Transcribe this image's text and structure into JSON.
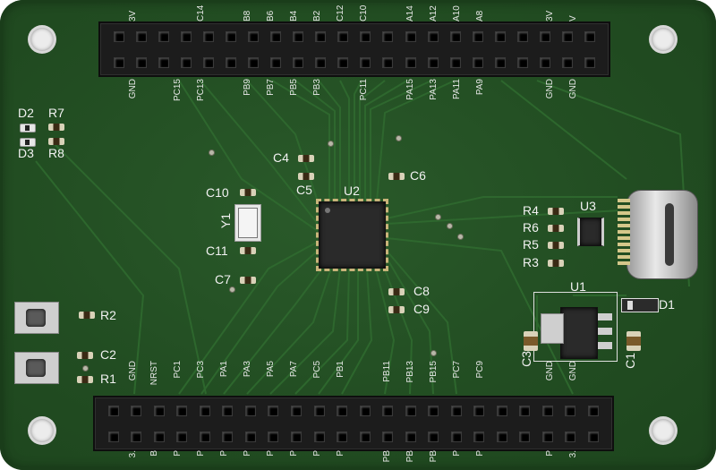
{
  "top_header_labels": {
    "upper": [
      "3V",
      "C14",
      "B8",
      "B6",
      "B4",
      "B2",
      "C12",
      "C10",
      "A14",
      "A12",
      "A10",
      "A8",
      "3V",
      "V"
    ],
    "lower": [
      "GND",
      "PC15",
      "PC13",
      "PB9",
      "PB7",
      "PB5",
      "PB3",
      "PC11",
      "PA15",
      "PA13",
      "PA11",
      "PA9",
      "GND",
      "GND"
    ]
  },
  "bottom_header_labels": {
    "upper": [
      "GND",
      "NRST",
      "PC1",
      "PC3",
      "PA1",
      "PA3",
      "PA5",
      "PA7",
      "PC5",
      "PB1",
      "PB11",
      "PB13",
      "PB15",
      "PC7",
      "PC9",
      "GND",
      "GND"
    ],
    "lower": [
      "3.",
      "B",
      "P",
      "P",
      "P",
      "P",
      "P",
      "P",
      "P",
      "P",
      "PB",
      "PB",
      "PB",
      "P",
      "P",
      "P",
      "3."
    ]
  },
  "refs": {
    "D2": "D2",
    "R7": "R7",
    "D3": "D3",
    "R8": "R8",
    "C4": "C4",
    "C5": "C5",
    "C6": "C6",
    "C10": "C10",
    "Y1": "Y1",
    "C11": "C11",
    "U2": "U2",
    "C7": "C7",
    "C8": "C8",
    "C9": "C9",
    "R4": "R4",
    "R6": "R6",
    "R5": "R5",
    "R3": "R3",
    "U3": "U3",
    "U1": "U1",
    "D1": "D1",
    "C3": "C3",
    "C1": "C1",
    "R2": "R2",
    "C2": "C2",
    "R1": "R1"
  },
  "colors": {
    "board": "#224d22",
    "silkscreen": "#f2f2f2",
    "header": "#1c1c1c"
  }
}
